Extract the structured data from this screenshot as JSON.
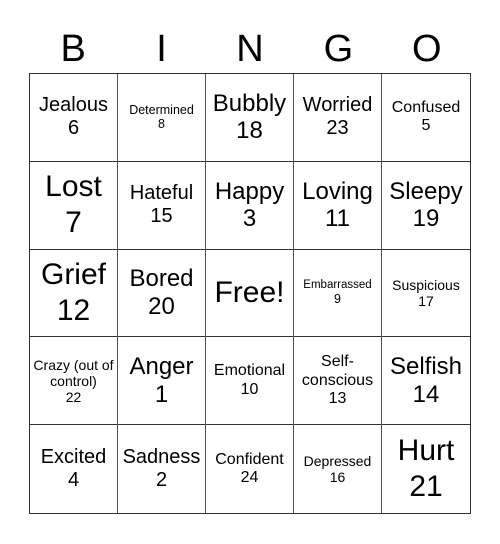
{
  "header": {
    "letters": [
      "B",
      "I",
      "N",
      "G",
      "O"
    ]
  },
  "cells": [
    {
      "word": "Jealous",
      "number": "6",
      "size": "s-md"
    },
    {
      "word": "Determined",
      "number": "8",
      "size": "s-xxs"
    },
    {
      "word": "Bubbly",
      "number": "18",
      "size": "s-lg"
    },
    {
      "word": "Worried",
      "number": "23",
      "size": "s-md"
    },
    {
      "word": "Confused",
      "number": "5",
      "size": "s-sm"
    },
    {
      "word": "Lost",
      "number": "7",
      "size": "s-xl"
    },
    {
      "word": "Hateful",
      "number": "15",
      "size": "s-md"
    },
    {
      "word": "Happy",
      "number": "3",
      "size": "s-lg"
    },
    {
      "word": "Loving",
      "number": "11",
      "size": "s-lg"
    },
    {
      "word": "Sleepy",
      "number": "19",
      "size": "s-lg"
    },
    {
      "word": "Grief",
      "number": "12",
      "size": "s-xl"
    },
    {
      "word": "Bored",
      "number": "20",
      "size": "s-lg"
    },
    {
      "word": "Free!",
      "number": "",
      "size": "free-text",
      "free": true
    },
    {
      "word": "Embarrassed",
      "number": "9",
      "size": "s-tiny"
    },
    {
      "word": "Suspicious",
      "number": "17",
      "size": "s-xs"
    },
    {
      "word": "Crazy (out of control)",
      "number": "22",
      "size": "s-xs"
    },
    {
      "word": "Anger",
      "number": "1",
      "size": "s-lg"
    },
    {
      "word": "Emotional",
      "number": "10",
      "size": "s-sm"
    },
    {
      "word": "Self-conscious",
      "number": "13",
      "size": "s-sm"
    },
    {
      "word": "Selfish",
      "number": "14",
      "size": "s-lg"
    },
    {
      "word": "Excited",
      "number": "4",
      "size": "s-md"
    },
    {
      "word": "Sadness",
      "number": "2",
      "size": "s-md"
    },
    {
      "word": "Confident",
      "number": "24",
      "size": "s-sm"
    },
    {
      "word": "Depressed",
      "number": "16",
      "size": "s-xs"
    },
    {
      "word": "Hurt",
      "number": "21",
      "size": "s-xl"
    }
  ]
}
